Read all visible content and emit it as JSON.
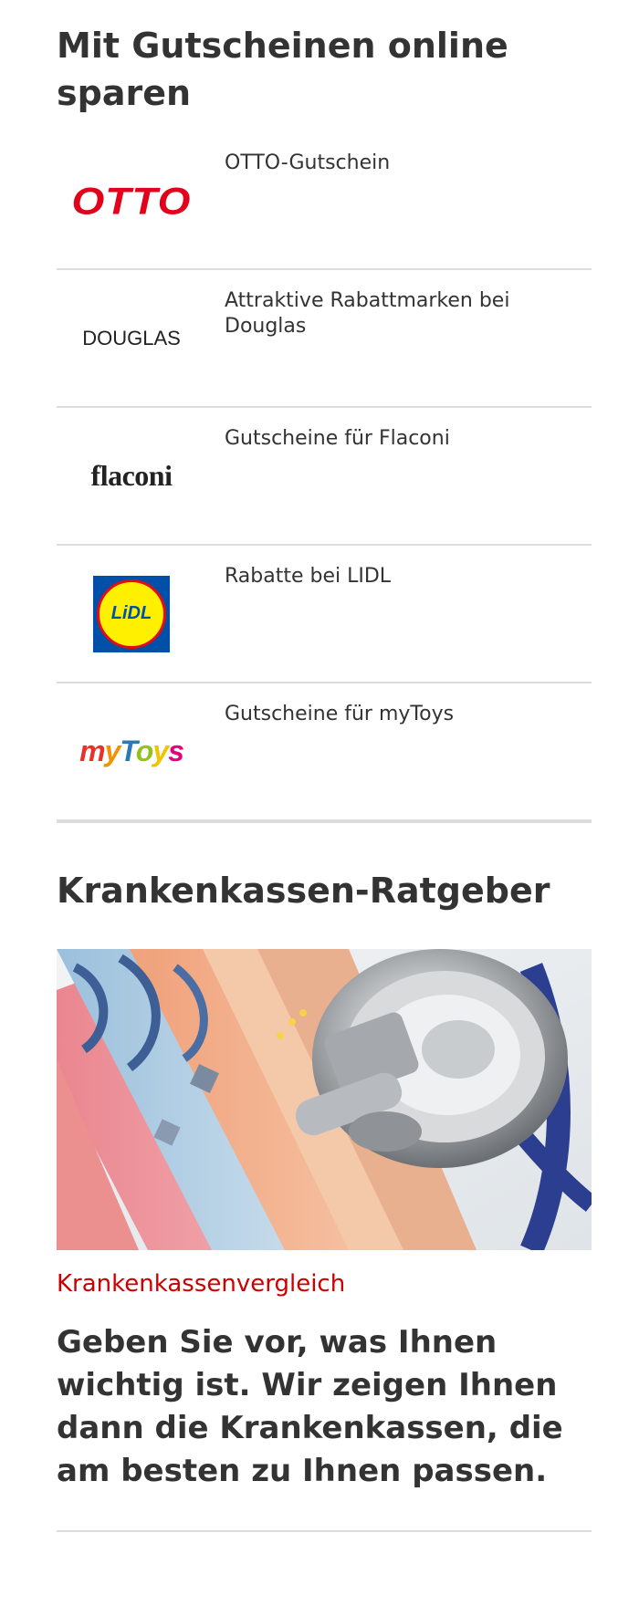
{
  "vouchers": {
    "heading": "Mit Gutscheinen online sparen",
    "items": [
      {
        "logo_text": "OTTO",
        "label": "OTTO-Gutschein"
      },
      {
        "logo_text": "DOUGLAS",
        "label": "Attraktive Rabattmarken bei Douglas"
      },
      {
        "logo_text": "flaconi",
        "label": "Gutscheine für Flaconi"
      },
      {
        "logo_text": "LiDL",
        "label": "Rabatte bei LIDL"
      },
      {
        "logo_text": "myToys",
        "label": "Gutscheine für myToys"
      }
    ]
  },
  "guide": {
    "heading": "Krankenkassen-Ratgeber",
    "image_icon": "stethoscope-on-euro-banknotes",
    "kicker": "Krankenkassenvergleich",
    "teaser": "Geben Sie vor, was Ihnen wichtig ist. Wir zeigen Ihnen dann die Krankenkassen, die am besten zu Ihnen passen."
  },
  "colors": {
    "accent_red": "#cc0000",
    "otto_red": "#e3001b",
    "lidl_blue": "#0050aa",
    "lidl_yellow": "#fff000",
    "divider": "#dcdcdc",
    "text": "#333333"
  }
}
